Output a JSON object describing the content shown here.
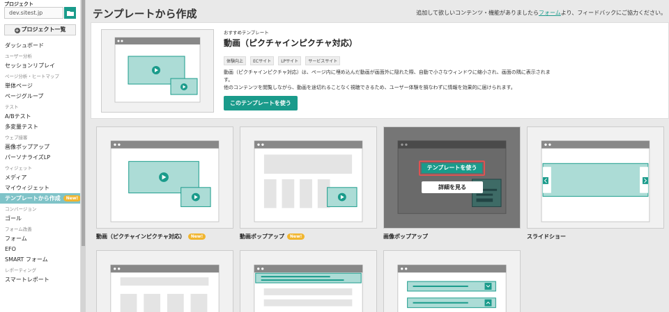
{
  "sidebar": {
    "project_label": "プロジェクト",
    "site": "dev.sitest.jp",
    "project_list_button": "プロジェクト一覧",
    "nav": [
      {
        "type": "item",
        "label": "ダッシュボード"
      },
      {
        "type": "section",
        "label": "ユーザー分析"
      },
      {
        "type": "item",
        "label": "セッションリプレイ"
      },
      {
        "type": "section",
        "label": "ページ分析・ヒートマップ"
      },
      {
        "type": "item",
        "label": "単体ページ"
      },
      {
        "type": "item",
        "label": "ページグループ"
      },
      {
        "type": "section",
        "label": "テスト"
      },
      {
        "type": "item",
        "label": "A/Bテスト"
      },
      {
        "type": "item",
        "label": "多変量テスト"
      },
      {
        "type": "section",
        "label": "ウェブ接客"
      },
      {
        "type": "item",
        "label": "画像ポップアップ"
      },
      {
        "type": "item",
        "label": "パーソナライズLP"
      },
      {
        "type": "section",
        "label": "ウィジェット"
      },
      {
        "type": "item",
        "label": "メディア"
      },
      {
        "type": "item",
        "label": "マイウィジェット"
      },
      {
        "type": "item",
        "label": "テンプレートから作成",
        "active": true,
        "badge": "New!"
      },
      {
        "type": "section",
        "label": "コンバージョン"
      },
      {
        "type": "item",
        "label": "ゴール"
      },
      {
        "type": "section",
        "label": "フォーム改善"
      },
      {
        "type": "item",
        "label": "フォーム"
      },
      {
        "type": "item",
        "label": "EFO"
      },
      {
        "type": "item",
        "label": "SMART フォーム"
      },
      {
        "type": "section",
        "label": "レポーティング"
      },
      {
        "type": "item",
        "label": "スマートレポート"
      }
    ]
  },
  "header": {
    "title": "テンプレートから作成",
    "feedback_pre": "追加して欲しいコンテンツ・機能がありましたら",
    "feedback_link": "フォーム",
    "feedback_post": "より、フィードバックにご協力ください。"
  },
  "recommended": {
    "sub": "おすすめテンプレート",
    "title": "動画（ピクチャインピクチャ対応）",
    "tags": [
      "体験向上",
      "ECサイト",
      "LPサイト",
      "サービスサイト"
    ],
    "desc1": "動画（ピクチャインピクチャ対応）は、ページ内に埋め込んだ動画が画面外に隠れた際、自動で小さなウィンドウに縮小され、画面の隅に表示されます。",
    "desc2": "他のコンテンツを閲覧しながら、動画を途切れることなく視聴できるため、ユーザー体験を損なわずに情報を効果的に届けられます。",
    "use_button": "このテンプレートを使う"
  },
  "cards": [
    {
      "label": "動画（ピクチャインピクチャ対応）",
      "badge": "New!"
    },
    {
      "label": "動画ポップアップ",
      "badge": "New!"
    },
    {
      "label": "画像ポップアップ",
      "badge": "",
      "use_button": "テンプレートを使う",
      "detail_button": "詳細を見る"
    },
    {
      "label": "スライドショー",
      "badge": ""
    }
  ],
  "colors": {
    "accent": "#1a9b8b",
    "highlight": "#e05252",
    "badge": "#f1b52e"
  }
}
